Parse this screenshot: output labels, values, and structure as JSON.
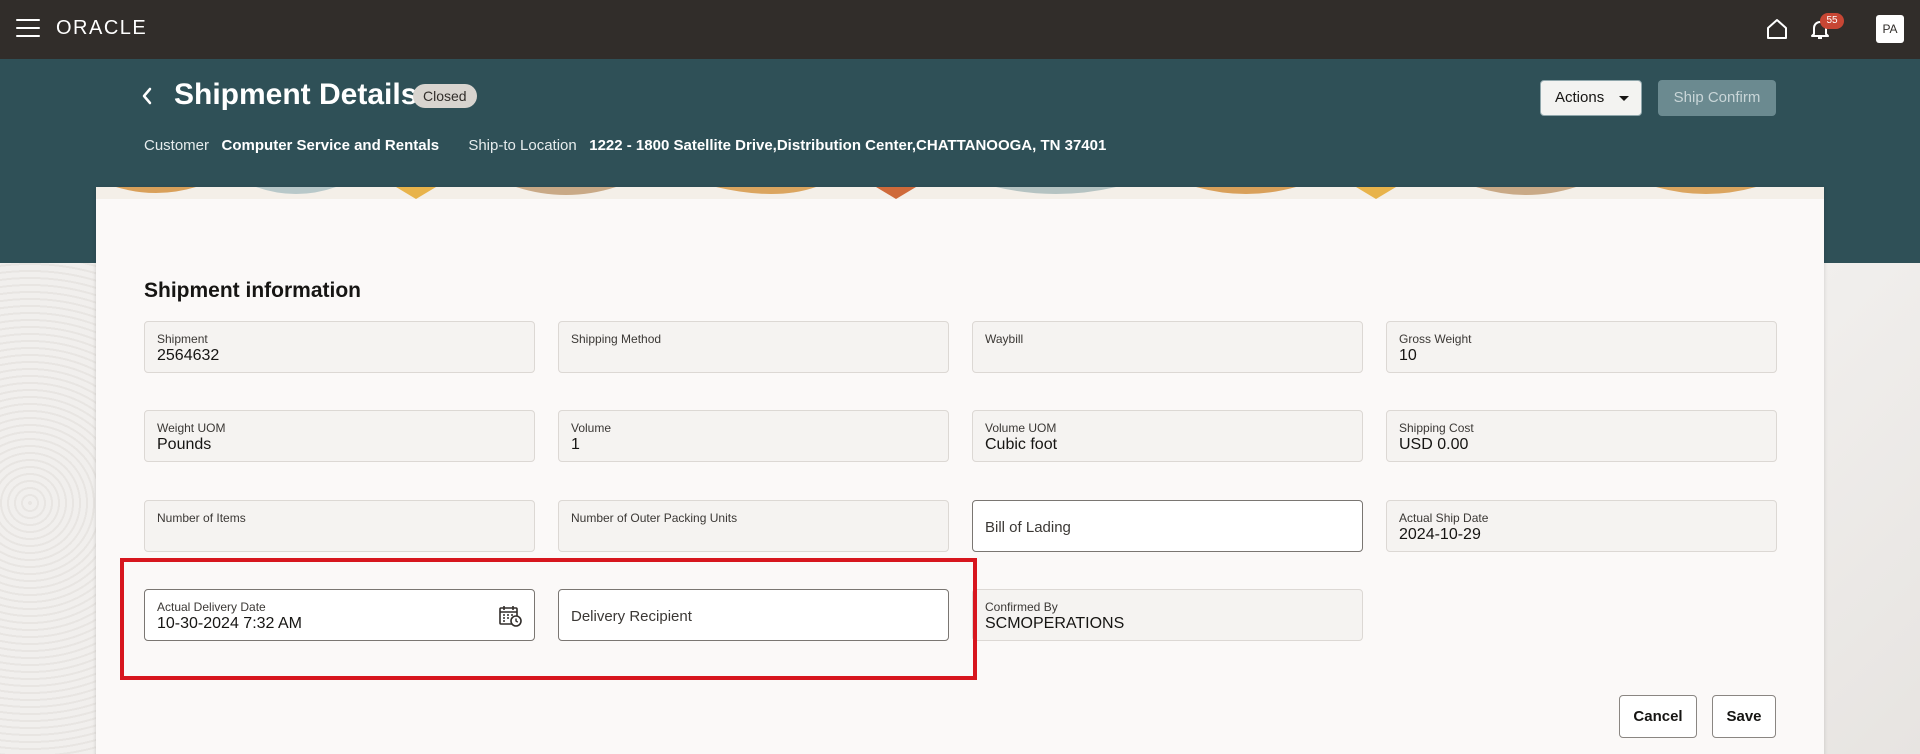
{
  "topbar": {
    "logo": "ORACLE",
    "notifications_count": "55",
    "avatar_initials": "PA"
  },
  "header": {
    "title": "Shipment Details",
    "status": "Closed",
    "actions_label": "Actions",
    "ship_confirm_label": "Ship Confirm",
    "customer_label": "Customer",
    "customer_value": "Computer Service and Rentals",
    "shipto_label": "Ship-to Location",
    "shipto_value": "1222 - 1800 Satellite Drive,Distribution Center,CHATTANOOGA, TN 37401"
  },
  "section": {
    "title": "Shipment information"
  },
  "fields": {
    "shipment": {
      "label": "Shipment",
      "value": "2564632"
    },
    "shipping_method": {
      "label": "Shipping Method",
      "value": ""
    },
    "waybill": {
      "label": "Waybill",
      "value": ""
    },
    "gross_weight": {
      "label": "Gross Weight",
      "value": "10"
    },
    "weight_uom": {
      "label": "Weight UOM",
      "value": "Pounds"
    },
    "volume": {
      "label": "Volume",
      "value": "1"
    },
    "volume_uom": {
      "label": "Volume UOM",
      "value": "Cubic foot"
    },
    "shipping_cost": {
      "label": "Shipping Cost",
      "value": "USD 0.00"
    },
    "number_of_items": {
      "label": "Number of Items",
      "value": ""
    },
    "outer_packing_units": {
      "label": "Number of Outer Packing Units",
      "value": ""
    },
    "bill_of_lading": {
      "label": "Bill of Lading",
      "value": ""
    },
    "actual_ship_date": {
      "label": "Actual Ship Date",
      "value": "2024-10-29"
    },
    "actual_delivery_date": {
      "label": "Actual Delivery Date",
      "value": "10-30-2024 7:32 AM"
    },
    "delivery_recipient": {
      "label": "Delivery Recipient",
      "value": ""
    },
    "confirmed_by": {
      "label": "Confirmed By",
      "value": "SCMOPERATIONS"
    }
  },
  "footer": {
    "cancel_label": "Cancel",
    "save_label": "Save"
  },
  "colors": {
    "topbar": "#312d2a",
    "header_band": "#2f5057",
    "highlight": "#d7161e",
    "badge": "#c74634"
  }
}
